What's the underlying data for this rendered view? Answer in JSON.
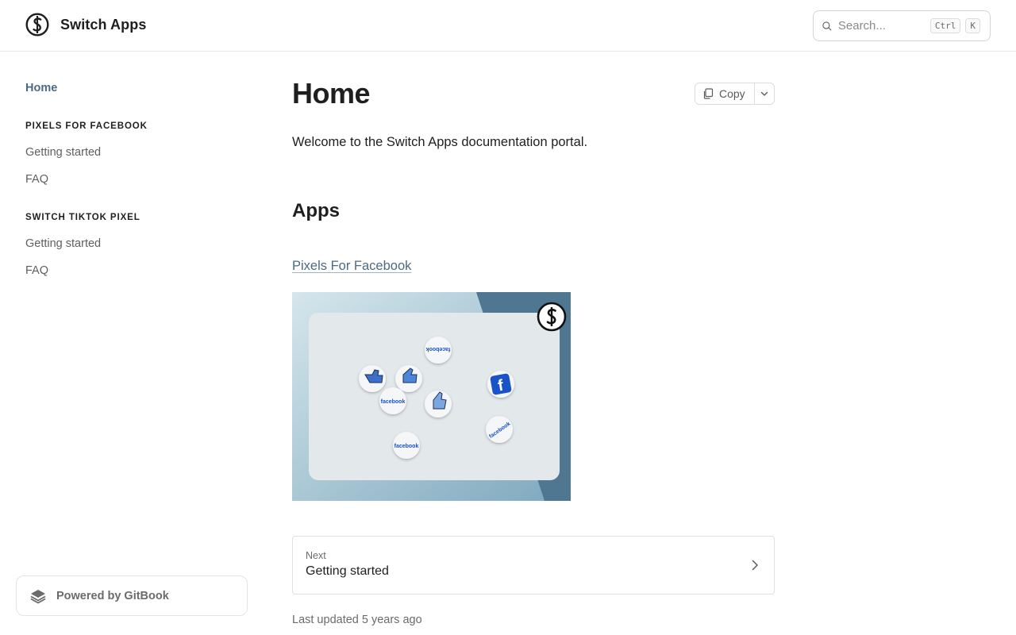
{
  "header": {
    "brand_name": "Switch Apps",
    "search": {
      "placeholder": "Search...",
      "shortcut_keys": [
        "Ctrl",
        "K"
      ]
    }
  },
  "sidebar": {
    "home_label": "Home",
    "sections": [
      {
        "title": "PIXELS FOR FACEBOOK",
        "items": [
          {
            "label": "Getting started"
          },
          {
            "label": "FAQ"
          }
        ]
      },
      {
        "title": "SWITCH TIKTOK PIXEL",
        "items": [
          {
            "label": "Getting started"
          },
          {
            "label": "FAQ"
          }
        ]
      }
    ],
    "powered_by": "Powered by GitBook"
  },
  "main": {
    "title": "Home",
    "copy_label": "Copy",
    "intro": "Welcome to the Switch Apps documentation portal.",
    "apps_heading": "Apps",
    "app_link": "Pixels For Facebook",
    "hero_badges": [
      "facebook",
      "facebook",
      "facebook",
      "facebook"
    ],
    "next": {
      "kicker": "Next",
      "title": "Getting started"
    },
    "last_updated": "Last updated 5 years ago"
  },
  "colors": {
    "accent": "#4a6b85",
    "text": "#1f1f1f",
    "muted": "#6b6b6b",
    "border": "#e0e0e0",
    "facebook_blue": "#1a52c8"
  }
}
